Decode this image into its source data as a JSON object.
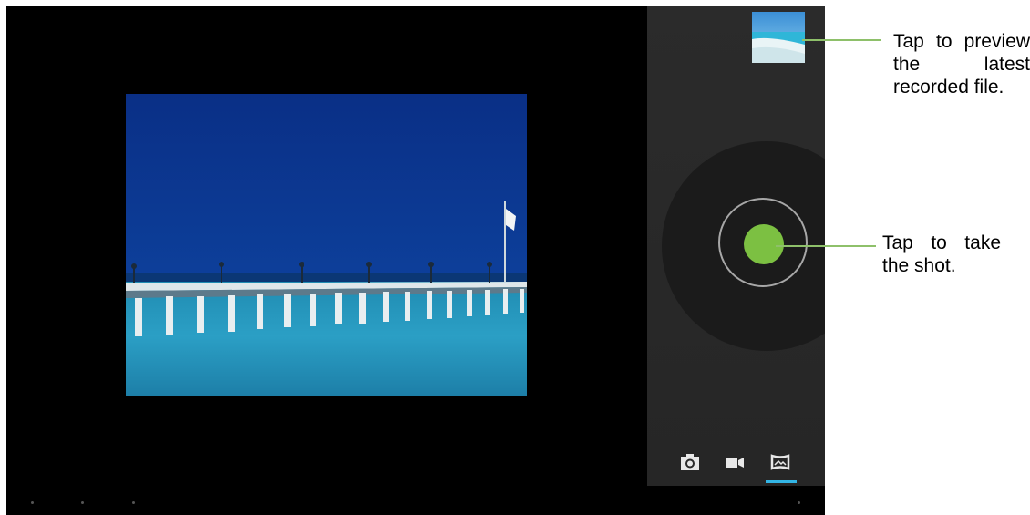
{
  "camera": {
    "modes": [
      {
        "name": "photo",
        "icon": "camera-icon"
      },
      {
        "name": "video",
        "icon": "video-camera-icon"
      },
      {
        "name": "panorama",
        "icon": "panorama-icon",
        "selected": true
      }
    ],
    "accent_color": "#33b5e5",
    "shutter_color": "#7cc042"
  },
  "annotations": {
    "preview_callout": "Tap to preview the latest recorded file.",
    "shutter_callout": "Tap to take the shot.",
    "line_color": "#8ec06a"
  }
}
